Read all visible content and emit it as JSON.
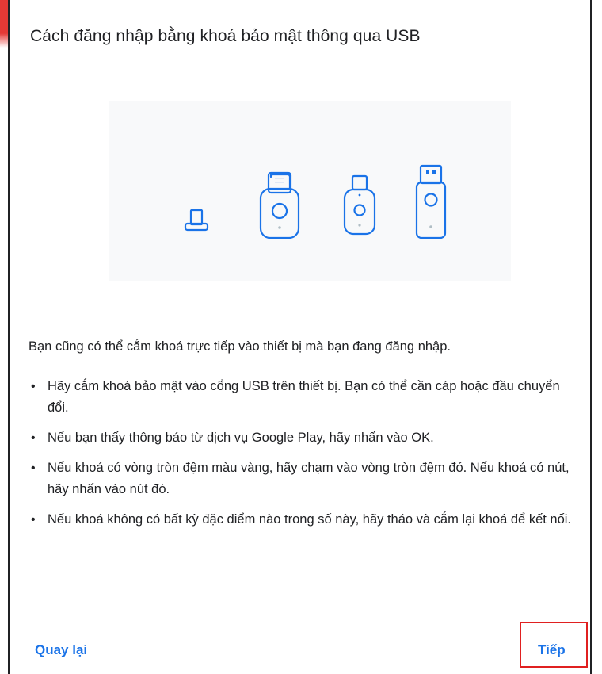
{
  "dialog": {
    "title": "Cách đăng nhập bằng khoá bảo mật thông qua USB",
    "description": "Bạn cũng có thể cắm khoá trực tiếp vào thiết bị mà bạn đang đăng nhập.",
    "tips": [
      "Hãy cắm khoá bảo mật vào cổng USB trên thiết bị. Bạn có thể cần cáp hoặc đầu chuyển đổi.",
      "Nếu bạn thấy thông báo từ dịch vụ Google Play, hãy nhấn vào OK.",
      "Nếu khoá có vòng tròn đệm màu vàng, hãy chạm vào vòng tròn đệm đó. Nếu khoá có nút, hãy nhấn vào nút đó.",
      "Nếu khoá không có bất kỳ đặc điểm nào trong số này, hãy tháo và cắm lại khoá để kết nối."
    ],
    "bullet": "•"
  },
  "actions": {
    "back_label": "Quay lại",
    "next_label": "Tiếp"
  },
  "colors": {
    "accent": "#1a73e8",
    "icon_stroke": "#1a73e8",
    "highlight_border": "#e02020"
  },
  "illustration": {
    "icons": [
      "usb-c-key-icon",
      "usb-a-key-icon",
      "small-usb-key-icon",
      "usb-key-with-button-icon"
    ]
  }
}
